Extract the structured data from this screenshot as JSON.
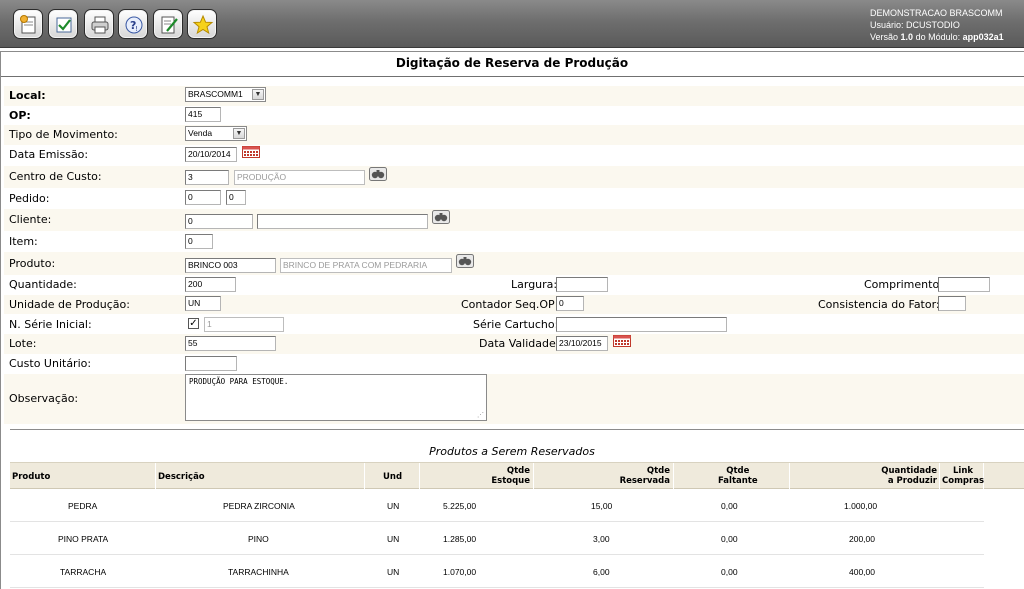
{
  "toolbar": {
    "buttons": [
      {
        "icon": "new-document-icon"
      },
      {
        "icon": "checkmark-icon"
      },
      {
        "icon": "printer-icon"
      },
      {
        "icon": "help-icon"
      },
      {
        "icon": "edit-icon"
      },
      {
        "icon": "star-icon"
      }
    ]
  },
  "system": {
    "company": "DEMONSTRACAO BRASCOMM",
    "user_label": "Usuário:",
    "user": "DCUSTODIO",
    "version_label": "Versão",
    "version": "1.0",
    "module_label": "do Módulo:",
    "module": "app032a1"
  },
  "page": {
    "title": "Digitação de Reserva de Produção"
  },
  "form": {
    "local": {
      "label": "Local:",
      "value": "BRASCOMM1"
    },
    "op": {
      "label": "OP:",
      "value": "415"
    },
    "tipo_movimento": {
      "label": "Tipo de Movimento:",
      "value": "Venda"
    },
    "data_emissao": {
      "label": "Data Emissão:",
      "value": "20/10/2014"
    },
    "centro_custo": {
      "label": "Centro de Custo:",
      "code": "3",
      "description": "PRODUÇÃO"
    },
    "pedido": {
      "label": "Pedido:",
      "value1": "0",
      "value2": "0"
    },
    "cliente": {
      "label": "Cliente:",
      "code": "0",
      "name": ""
    },
    "item": {
      "label": "Item:",
      "value": "0"
    },
    "produto": {
      "label": "Produto:",
      "code": "BRINCO 003",
      "description": "BRINCO DE PRATA COM PEDRARIA"
    },
    "quantidade": {
      "label": "Quantidade:",
      "value": "200"
    },
    "largura": {
      "label": "Largura:",
      "value": ""
    },
    "comprimento": {
      "label": "Comprimento:",
      "value": ""
    },
    "unidade_producao": {
      "label": "Unidade de Produção:",
      "value": "UN"
    },
    "contador_seq_op": {
      "label": "Contador Seq.OP:",
      "value": "0"
    },
    "consistencia_fator": {
      "label": "Consistencia do Fator:",
      "value": ""
    },
    "n_serie_inicial": {
      "label": "N. Série Inicial:",
      "checked": true,
      "value": "1"
    },
    "serie_cartucho": {
      "label": "Série Cartucho:",
      "value": ""
    },
    "lote": {
      "label": "Lote:",
      "value": "55"
    },
    "data_validade": {
      "label": "Data Validade:",
      "value": "23/10/2015"
    },
    "custo_unitario": {
      "label": "Custo Unitário:",
      "value": ""
    },
    "observacao": {
      "label": "Observação:",
      "value": "PRODUÇÃO PARA ESTOQUE."
    }
  },
  "products": {
    "title": "Produtos a Serem Reservados",
    "headers": {
      "produto": "Produto",
      "descricao": "Descrição",
      "und": "Und",
      "qtde_estoque": "Qtde\nEstoque",
      "qtde_reservada": "Qtde\nReservada",
      "qtde_faltante": "Qtde\nFaltante",
      "qtd_produzir": "Quantidade\na Produzir",
      "link_compras": "Link\nCompras"
    },
    "rows": [
      {
        "produto": "PEDRA",
        "descricao": "PEDRA ZIRCONIA",
        "und": "UN",
        "estoque": "5.225,00",
        "reservada": "15,00",
        "faltante": "0,00",
        "produzir": "1.000,00"
      },
      {
        "produto": "PINO PRATA",
        "descricao": "PINO",
        "und": "UN",
        "estoque": "1.285,00",
        "reservada": "3,00",
        "faltante": "0,00",
        "produzir": "200,00"
      },
      {
        "produto": "TARRACHA",
        "descricao": "TARRACHINHA",
        "und": "UN",
        "estoque": "1.070,00",
        "reservada": "6,00",
        "faltante": "0,00",
        "produzir": "400,00"
      }
    ]
  }
}
